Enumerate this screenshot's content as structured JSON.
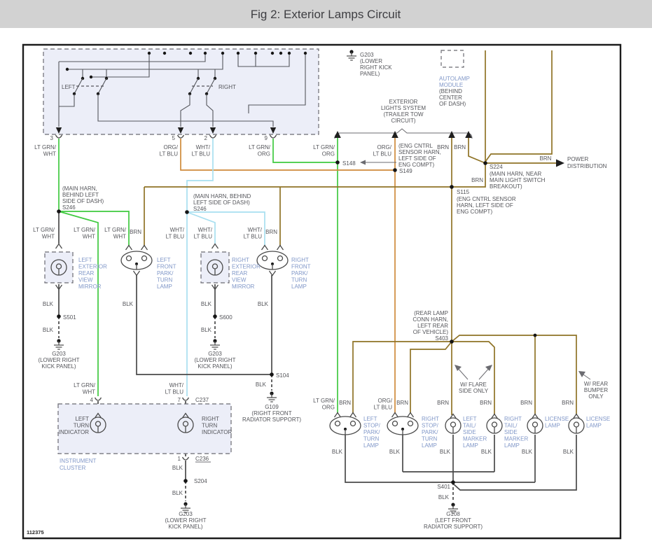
{
  "header": {
    "title": "Fig 2: Exterior Lamps Circuit"
  },
  "sheet": {
    "figure_number": "112375"
  },
  "colors": {
    "header_bg": "#d2d2d2",
    "lt_grn": "#3fc93f",
    "org": "#cf8a3a",
    "lt_blu": "#a8dff0",
    "brn": "#8f7326",
    "blk_wire": "#4a4a4a",
    "component_blue": "#8097c8",
    "label_gray": "#54555a",
    "box_fill": "#eceef8"
  },
  "switch_box": {
    "left": "LEFT",
    "right": "RIGHT",
    "pin3": "3",
    "pin5": "5",
    "pin2": "2",
    "pin9": "9"
  },
  "wires": {
    "lt_grn_wht": [
      "LT GRN/",
      "WHT"
    ],
    "org_lt_blu": [
      "ORG/",
      "LT BLU"
    ],
    "wht_lt_blu": [
      "WHT/",
      "LT BLU"
    ],
    "lt_grn_org": [
      "LT GRN/",
      "ORG"
    ],
    "brn": "BRN",
    "blk": "BLK"
  },
  "splices": {
    "s246": "S246",
    "s148": "S148",
    "s149": "S149",
    "s115": "S115",
    "s224": "S224",
    "s104": "S104",
    "s501": "S501",
    "s600": "S600",
    "s204": "S204",
    "s403": "S403",
    "s401": "S401"
  },
  "grounds": {
    "g203": "G203",
    "g109": "G109",
    "g108": "G108",
    "g203_loc2": [
      "(LOWER RIGHT",
      "KICK PANEL)"
    ],
    "g203_loc4": [
      "(LOWER",
      "RIGHT KICK",
      "PANEL)"
    ],
    "g109_loc": [
      "(RIGHT FRONT",
      "RADIATOR SUPPORT)"
    ],
    "g108_loc": [
      "(LEFT FRONT",
      "RADIATOR SUPPORT)"
    ]
  },
  "annotations": {
    "exterior_lights": [
      "EXTERIOR",
      "LIGHTS SYSTEM",
      "(TRAILER TOW",
      "CIRCUIT)"
    ],
    "autolamp": [
      "AUTOLAMP",
      "MODULE"
    ],
    "autolamp_loc": [
      "(BEHIND",
      "CENTER",
      "OF DASH)"
    ],
    "main_harn_3": [
      "(MAIN HARN,",
      "BEHIND LEFT",
      "SIDE OF DASH)"
    ],
    "main_harn_2": [
      "(MAIN HARN, BEHIND",
      "LEFT SIDE OF DASH)"
    ],
    "eng_cntrl_4": [
      "(ENG CNTRL",
      "SENSOR HARN,",
      "LEFT SIDE OF",
      "ENG COMPT)"
    ],
    "s224_loc": [
      "(MAIN HARN, NEAR",
      "MAIN LIGHT SWITCH",
      "BREAKOUT)"
    ],
    "s115_loc": [
      "(ENG CNTRL SENSOR",
      "HARN, LEFT SIDE OF",
      "ENG COMPT)"
    ],
    "rear_harn": [
      "(REAR LAMP",
      "CONN HARN,",
      "LEFT REAR",
      "OF VEHICLE)"
    ],
    "w_flare": [
      "W/ FLARE",
      "SIDE ONLY"
    ],
    "w_rear_bumper": [
      "W/ REAR",
      "BUMPER",
      "ONLY"
    ],
    "power_distribution": [
      "POWER",
      "DISTRIBUTION"
    ]
  },
  "components": {
    "left_mirror": [
      "LEFT",
      "EXTERIOR",
      "REAR",
      "VIEW",
      "MIRROR"
    ],
    "right_mirror": [
      "RIGHT",
      "EXTERIOR",
      "REAR",
      "VIEW",
      "MIRROR"
    ],
    "left_front": [
      "LEFT",
      "FRONT",
      "PARK/",
      "TURN",
      "LAMP"
    ],
    "right_front": [
      "RIGHT",
      "FRONT",
      "PARK/",
      "TURN",
      "LAMP"
    ],
    "left_stop": [
      "LEFT",
      "STOP/",
      "PARK/",
      "TURN",
      "LAMP"
    ],
    "right_stop": [
      "RIGHT",
      "STOP/",
      "PARK/",
      "TURN",
      "LAMP"
    ],
    "left_tail": [
      "LEFT",
      "TAIL/",
      "SIDE",
      "MARKER",
      "LAMP"
    ],
    "right_tail": [
      "RIGHT",
      "TAIL/",
      "SIDE",
      "MARKER",
      "LAMP"
    ],
    "license": [
      "LICENSE",
      "LAMP"
    ],
    "instrument_cluster": [
      "INSTRUMENT",
      "CLUSTER"
    ],
    "left_turn": [
      "LEFT",
      "TURN",
      "INDICATOR"
    ],
    "right_turn": [
      "RIGHT",
      "TURN",
      "INDICATOR"
    ]
  },
  "connectors": {
    "c237": "C237",
    "c236": "C236",
    "pin4": "4",
    "pin7": "7",
    "pin1": "1"
  }
}
